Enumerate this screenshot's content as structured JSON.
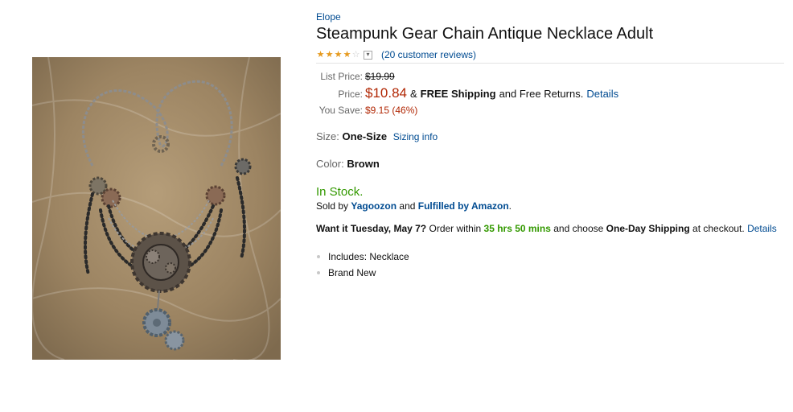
{
  "product": {
    "brand": "Elope",
    "title": "Steampunk Gear Chain Antique Necklace Adult",
    "image_alt": "necklace-product-image"
  },
  "rating": {
    "stars_value": 3.5,
    "stars_total": 5,
    "dropdown_icon": "chevron-down-icon",
    "reviews_text": "(20 customer reviews)"
  },
  "price": {
    "list_label": "List Price:",
    "list_value": "$19.99",
    "price_label": "Price:",
    "price_value": "$10.84",
    "amp": "&",
    "free_shipping": "FREE Shipping",
    "free_returns": "and Free Returns.",
    "details_link": "Details",
    "save_label": "You Save:",
    "save_value": "$9.15 (46%)"
  },
  "size": {
    "label": "Size:",
    "value": "One-Size",
    "info_link": "Sizing info"
  },
  "color": {
    "label": "Color:",
    "value": "Brown"
  },
  "availability": {
    "stock": "In Stock.",
    "sold_prefix": "Sold by",
    "seller": "Yagoozon",
    "and": "and",
    "fulfilled": "Fulfilled by Amazon",
    "period": "."
  },
  "delivery": {
    "want": "Want it Tuesday, May 7?",
    "order_within": "Order within",
    "countdown": "35 hrs 50 mins",
    "choose": "and choose",
    "method": "One-Day Shipping",
    "at_checkout": "at checkout.",
    "details_link": "Details"
  },
  "features": [
    "Includes: Necklace",
    "Brand New"
  ],
  "colors": {
    "link": "#004b91",
    "price_red": "#b12704",
    "stock_green": "#339900",
    "star_orange": "#e69a1e"
  }
}
